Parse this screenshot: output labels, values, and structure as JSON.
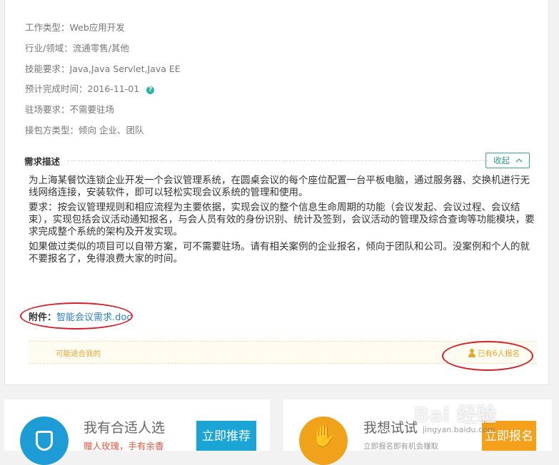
{
  "fields": [
    {
      "label": "工作类型：",
      "value": "Web应用开发"
    },
    {
      "label": "行业/领域：",
      "value": "流通零售/其他"
    },
    {
      "label": "技能要求：",
      "value": "Java,Java Servlet,Java EE"
    },
    {
      "label": "预计完成时间：",
      "value": "2016-11-01"
    },
    {
      "label": "驻场要求：",
      "value": "不需要驻场"
    },
    {
      "label": "接包方类型：",
      "value": "倾向 企业、团队"
    }
  ],
  "help_icon": "?",
  "section": {
    "title": "需求描述",
    "collapse_label": "收起",
    "collapse_icon": "chevron-up-icon"
  },
  "description": [
    "为上海某餐饮连锁企业开发一个会议管理系统，在圆桌会议的每个座位配置一台平板电脑，通过服务器、交换机进行无线网络连接，安装软件，即可以轻松实现会议系统的管理和使用。",
    "要求：按会议管理规则和相应流程为主要依据，实现会议的整个信息生命周期的功能（会议发起、会议过程、会议结束），实现包括会议活动通知报名，与会人员有效的身份识别、统计及签到，会议活动的管理及综合查询等功能模块，要求完成整个系统的架构及开发实现。",
    "如果做过类似的项目可以自带方案，可不需要驻场。请有相关案例的企业报名，倾向于团队和公司。没案例和个人的就不要报名了，免得浪费大家的时间。"
  ],
  "attachment": {
    "label": "附件：",
    "filename": "智能会议需求.doc"
  },
  "match_bar": {
    "maybe_label": "可能适合我的",
    "signup_count": "已有6人报名"
  },
  "panels": [
    {
      "title": "我有合适人选",
      "subtitle": "赠人玫瑰，手有余香",
      "button": "立即推荐"
    },
    {
      "title": "我想试试",
      "subtitle": "立即报名即有机会赚取",
      "button": "立即报名"
    }
  ],
  "watermark": {
    "logo": "Bai 经验",
    "url": "jingyan.baidu.com"
  },
  "colors": {
    "accent_teal": "#2b9a8a",
    "link": "#2a7fc7",
    "annotation": "#d4202a",
    "blue_button": "#1ba4d6",
    "orange_button": "#f5a01a"
  }
}
